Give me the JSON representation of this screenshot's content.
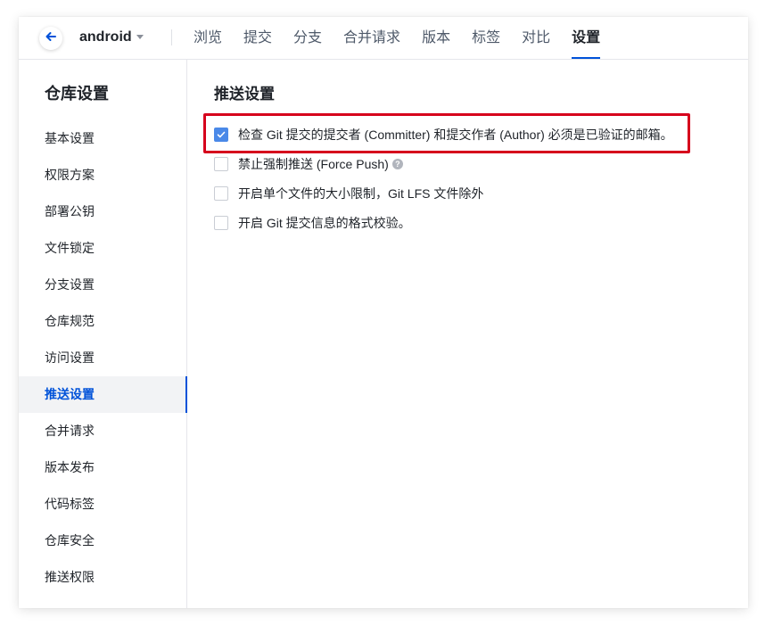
{
  "header": {
    "repo_name": "android",
    "tabs": [
      {
        "label": "浏览"
      },
      {
        "label": "提交"
      },
      {
        "label": "分支"
      },
      {
        "label": "合并请求"
      },
      {
        "label": "版本"
      },
      {
        "label": "标签"
      },
      {
        "label": "对比"
      },
      {
        "label": "设置"
      }
    ],
    "active_tab": "设置"
  },
  "sidebar": {
    "title": "仓库设置",
    "items": [
      {
        "label": "基本设置"
      },
      {
        "label": "权限方案"
      },
      {
        "label": "部署公钥"
      },
      {
        "label": "文件锁定"
      },
      {
        "label": "分支设置"
      },
      {
        "label": "仓库规范"
      },
      {
        "label": "访问设置"
      },
      {
        "label": "推送设置"
      },
      {
        "label": "合并请求"
      },
      {
        "label": "版本发布"
      },
      {
        "label": "代码标签"
      },
      {
        "label": "仓库安全"
      },
      {
        "label": "推送权限"
      }
    ],
    "active_item": "推送设置"
  },
  "main": {
    "title": "推送设置",
    "options": [
      {
        "label": "检查 Git 提交的提交者 (Committer) 和提交作者 (Author) 必须是已验证的邮箱。",
        "checked": true
      },
      {
        "label": "禁止强制推送 (Force Push)",
        "checked": false,
        "help": "?"
      },
      {
        "label": "开启单个文件的大小限制，Git LFS 文件除外",
        "checked": false
      },
      {
        "label": "开启 Git 提交信息的格式校验。",
        "checked": false
      }
    ]
  },
  "colors": {
    "accent": "#0052d9",
    "checkbox_checked": "#4a89e8",
    "highlight": "#d6001c"
  }
}
